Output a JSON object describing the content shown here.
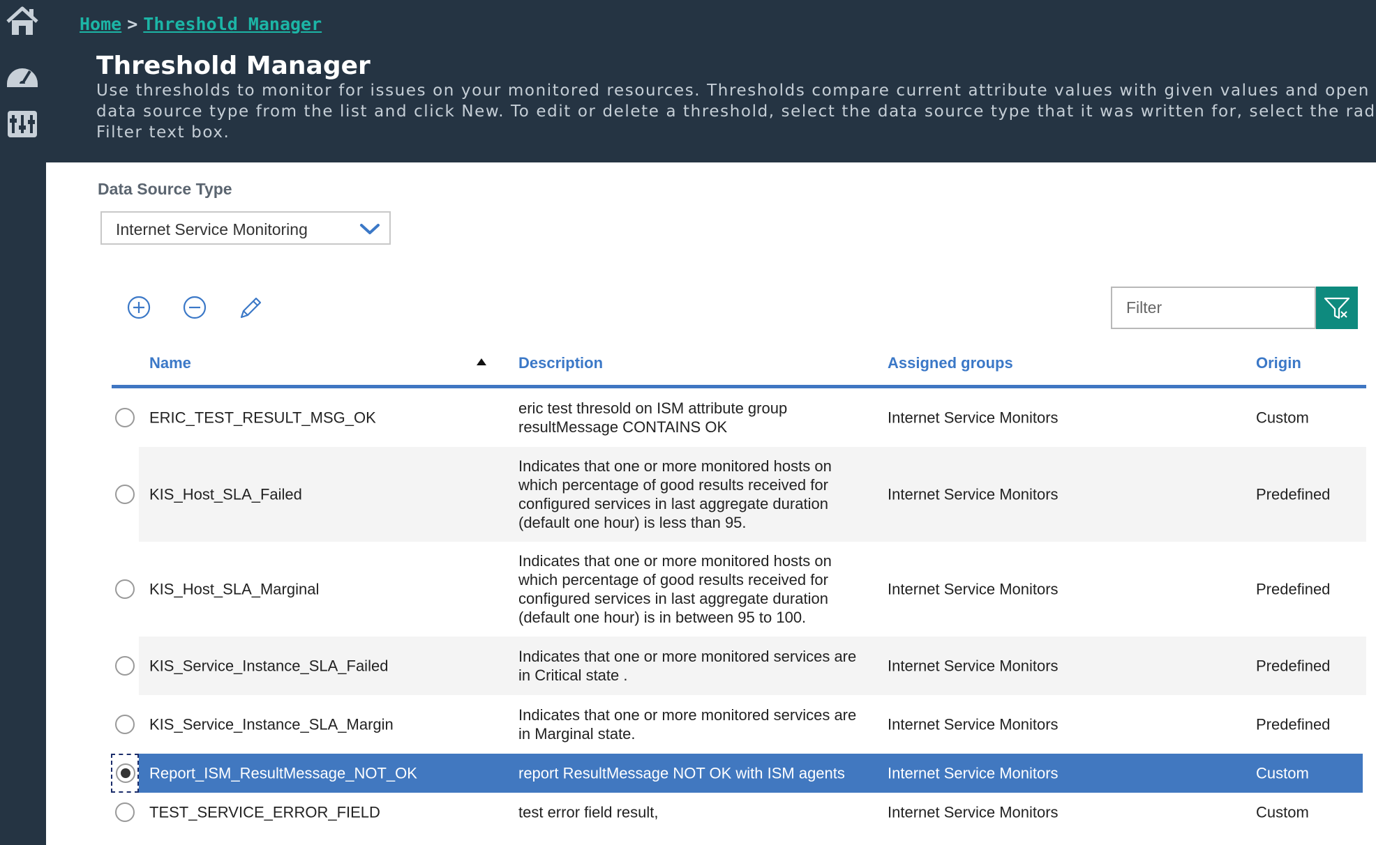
{
  "colors": {
    "rail_bg": "#253443",
    "header_bg": "#253443",
    "accent_teal": "#1cb5a6",
    "link_blue": "#3b78c7",
    "selected_row": "#4178c0",
    "filter_button": "#0e8a7e"
  },
  "rail": {
    "icons": [
      "home-icon",
      "dashboard-gauge-icon",
      "threshold-manager-icon"
    ]
  },
  "breadcrumb": {
    "home": "Home",
    "separator": ">",
    "current": "Threshold Manager"
  },
  "header": {
    "title": "Threshold Manager",
    "description_lines": [
      "Use thresholds to monitor for issues on your monitored resources. Thresholds compare current attribute values with given values and open an eve",
      "data source type from the list and click New. To edit or delete a threshold, select the data source type that it was written for, select the radio butt",
      "Filter text box."
    ]
  },
  "data_source": {
    "label": "Data Source Type",
    "selected": "Internet Service Monitoring"
  },
  "toolbar": {
    "icons": [
      "add-icon",
      "remove-icon",
      "edit-icon"
    ]
  },
  "filter": {
    "placeholder": "Filter",
    "icon": "filter-icon"
  },
  "table": {
    "columns": {
      "name": "Name",
      "description": "Description",
      "groups": "Assigned groups",
      "origin": "Origin"
    },
    "sort": {
      "column": "name",
      "direction": "ascending"
    },
    "rows": [
      {
        "name": "ERIC_TEST_RESULT_MSG_OK",
        "description": [
          "eric test thresold on ISM attribute group",
          "resultMessage CONTAINS OK"
        ],
        "group": "Internet Service Monitors",
        "origin": "Custom",
        "selected": false
      },
      {
        "name": "KIS_Host_SLA_Failed",
        "description": [
          "Indicates that one or more monitored hosts on",
          "which percentage of good results received for",
          "configured services in last aggregate duration",
          "(default one hour) is less than 95."
        ],
        "group": "Internet Service Monitors",
        "origin": "Predefined",
        "selected": false
      },
      {
        "name": "KIS_Host_SLA_Marginal",
        "description": [
          "Indicates that one or more monitored hosts on",
          "which percentage of good results received for",
          "configured services in last aggregate duration",
          "(default one hour) is in between 95 to 100."
        ],
        "group": "Internet Service Monitors",
        "origin": "Predefined",
        "selected": false
      },
      {
        "name": "KIS_Service_Instance_SLA_Failed",
        "description": [
          "Indicates that one or more monitored services are",
          "in Critical state ."
        ],
        "group": "Internet Service Monitors",
        "origin": "Predefined",
        "selected": false
      },
      {
        "name": "KIS_Service_Instance_SLA_Margin",
        "description": [
          "Indicates that one or more monitored services are",
          "in Marginal state."
        ],
        "group": "Internet Service Monitors",
        "origin": "Predefined",
        "selected": false
      },
      {
        "name": "Report_ISM_ResultMessage_NOT_OK",
        "description": [
          "report ResultMessage NOT OK with ISM agents"
        ],
        "group": "Internet Service Monitors",
        "origin": "Custom",
        "selected": true
      },
      {
        "name": "TEST_SERVICE_ERROR_FIELD",
        "description": [
          "test error field result,"
        ],
        "group": "Internet Service Monitors",
        "origin": "Custom",
        "selected": false
      }
    ]
  }
}
